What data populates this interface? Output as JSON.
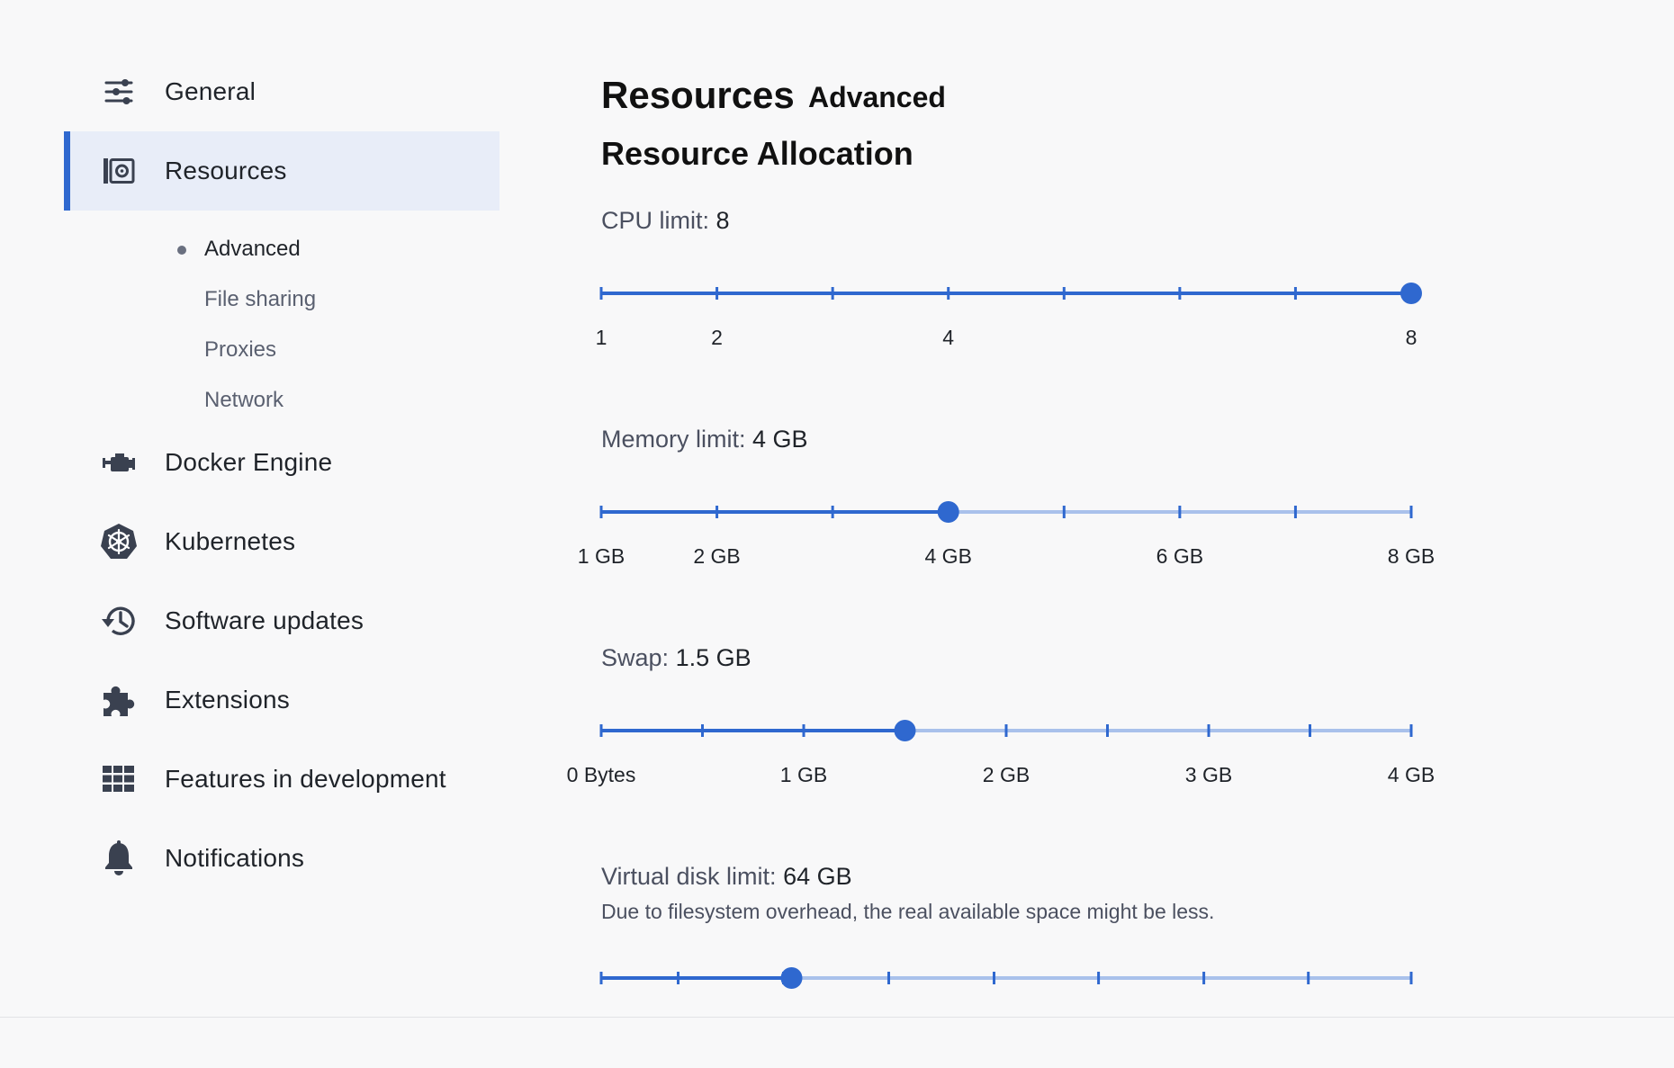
{
  "colors": {
    "accent": "#2f68cf",
    "track_inactive": "#a9c1eb",
    "active_nav_bg": "#e8edf8"
  },
  "sidebar": {
    "items": [
      {
        "label": "General",
        "icon": "sliders-icon"
      },
      {
        "label": "Resources",
        "icon": "resources-icon",
        "active": true
      },
      {
        "label": "Docker Engine",
        "icon": "engine-icon"
      },
      {
        "label": "Kubernetes",
        "icon": "kubernetes-icon"
      },
      {
        "label": "Software updates",
        "icon": "history-icon"
      },
      {
        "label": "Extensions",
        "icon": "puzzle-icon"
      },
      {
        "label": "Features in development",
        "icon": "grid-icon"
      },
      {
        "label": "Notifications",
        "icon": "bell-icon"
      }
    ],
    "subitems": [
      {
        "label": "Advanced",
        "selected": true
      },
      {
        "label": "File sharing"
      },
      {
        "label": "Proxies"
      },
      {
        "label": "Network"
      }
    ]
  },
  "main": {
    "tabs": [
      "Resources",
      "Advanced"
    ],
    "section_title": "Resource Allocation",
    "settings": {
      "cpu": {
        "label": "CPU limit:",
        "value": "8",
        "slider": {
          "fraction": 1.0,
          "ticks": 8,
          "labels": [
            [
              "1",
              0
            ],
            [
              "2",
              0.142857
            ],
            [
              "4",
              0.428571
            ],
            [
              "8",
              1
            ]
          ]
        }
      },
      "memory": {
        "label": "Memory limit:",
        "value": "4 GB",
        "slider": {
          "fraction": 0.428571,
          "ticks": 8,
          "labels": [
            [
              "1 GB",
              0
            ],
            [
              "2 GB",
              0.142857
            ],
            [
              "4 GB",
              0.428571
            ],
            [
              "6 GB",
              0.714286
            ],
            [
              "8 GB",
              1
            ]
          ]
        }
      },
      "swap": {
        "label": "Swap:",
        "value": "1.5 GB",
        "slider": {
          "fraction": 0.375,
          "ticks": 9,
          "labels": [
            [
              "0 Bytes",
              0
            ],
            [
              "1 GB",
              0.25
            ],
            [
              "2 GB",
              0.5
            ],
            [
              "3 GB",
              0.75
            ],
            [
              "4 GB",
              1
            ]
          ]
        }
      },
      "disk": {
        "label": "Virtual disk limit:",
        "value": "64 GB",
        "description": "Due to filesystem overhead, the real available space might be less.",
        "slider": {
          "fraction": 0.235,
          "ticks": 9,
          "tick_positions": [
            0,
            0.095,
            0.225,
            0.355,
            0.485,
            0.614,
            0.744,
            0.873,
            1
          ],
          "labels": []
        }
      }
    }
  }
}
